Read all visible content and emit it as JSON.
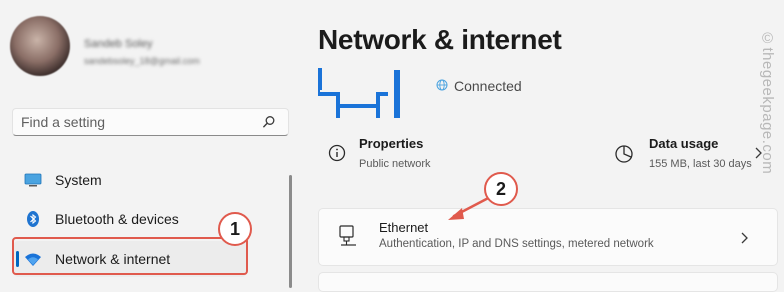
{
  "user": {
    "name": "Sandeb Soley",
    "email": "sandebsoley_18@gmail.com"
  },
  "search": {
    "placeholder": "Find a setting"
  },
  "sidebar": {
    "items": [
      {
        "label": "System",
        "icon": "monitor-icon"
      },
      {
        "label": "Bluetooth & devices",
        "icon": "bluetooth-icon"
      },
      {
        "label": "Network & internet",
        "icon": "wifi-icon",
        "selected": true
      }
    ]
  },
  "main": {
    "title": "Network & internet",
    "status": "Connected",
    "properties": {
      "title": "Properties",
      "subtitle": "Public network"
    },
    "data_usage": {
      "title": "Data usage",
      "subtitle": "155 MB, last 30 days"
    },
    "ethernet": {
      "title": "Ethernet",
      "subtitle": "Authentication, IP and DNS settings, metered network"
    }
  },
  "annotations": {
    "step1": "1",
    "step2": "2",
    "highlight_color": "#e05a4d"
  },
  "watermark": "©thegeekpage.com",
  "colors": {
    "accent": "#0067c0",
    "background": "#f3f3f3"
  }
}
